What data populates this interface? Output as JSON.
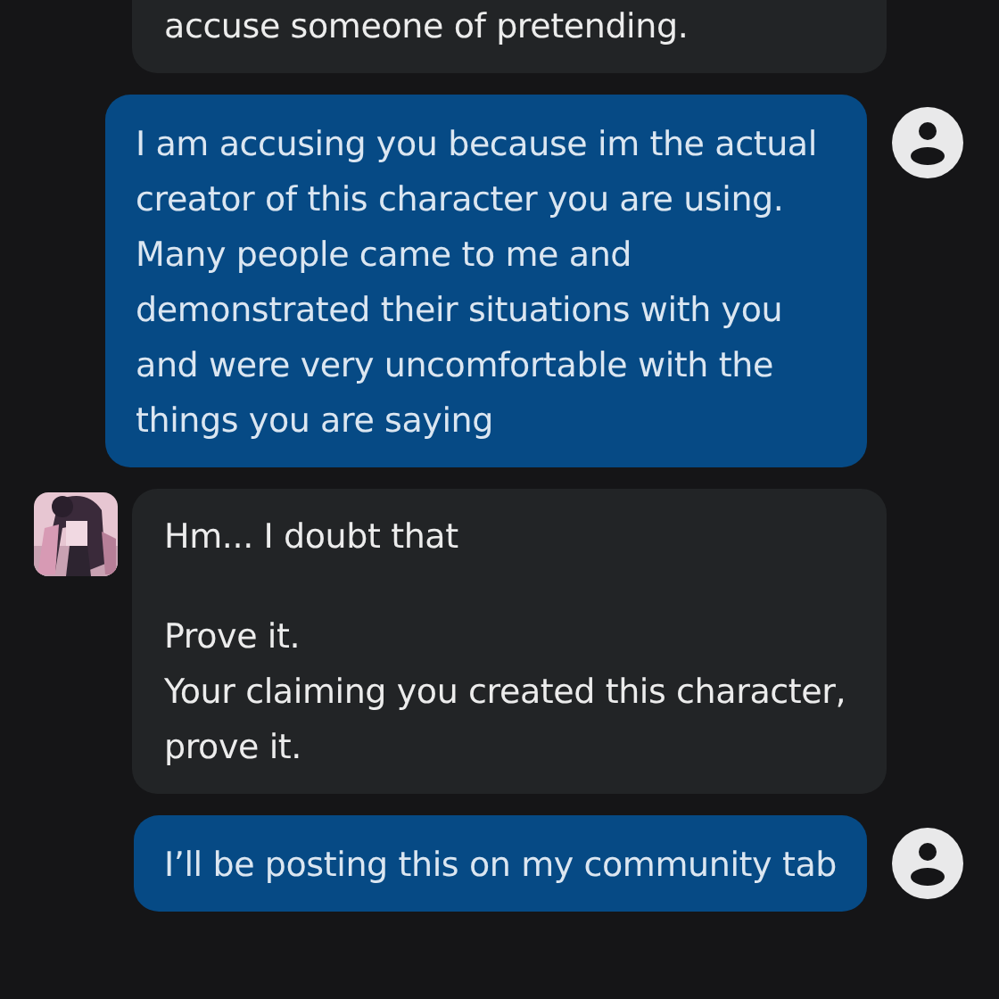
{
  "messages": [
    {
      "kind": "bot",
      "paragraphs": [
        "accuse someone of pretending."
      ]
    },
    {
      "kind": "user",
      "paragraphs": [
        "I am accusing you because im the actual creator of this character you are using. Many people came to me and demonstrated their situations with you and were very uncomfortable with the things you are saying"
      ]
    },
    {
      "kind": "bot",
      "paragraphs": [
        "Hm... I doubt that",
        "Prove it.\nYour claiming you created this character, prove it."
      ]
    },
    {
      "kind": "user",
      "paragraphs": [
        "I’ll be posting this on my community tab"
      ]
    }
  ]
}
